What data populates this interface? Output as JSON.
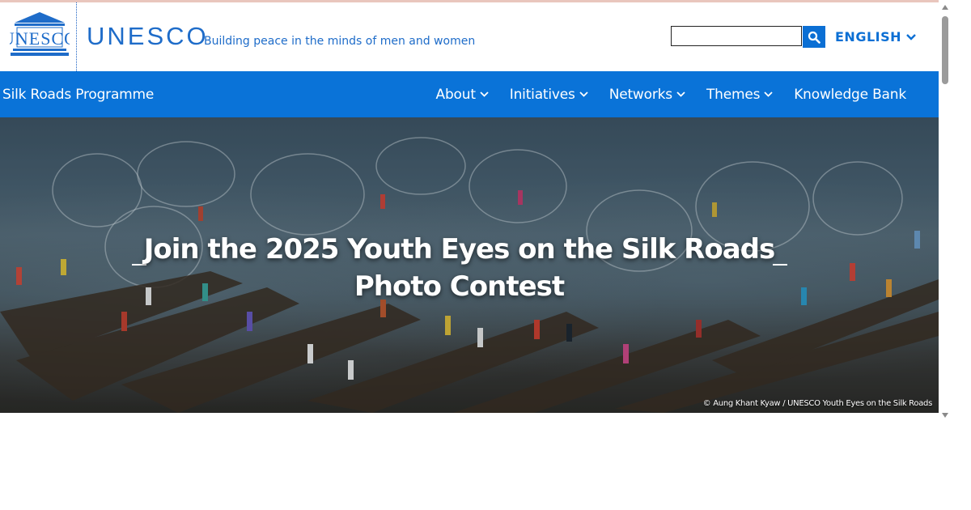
{
  "header": {
    "logo_text": "UNESCO",
    "brand": "UNESCO",
    "tagline": "Building peace in the minds of men and women",
    "search": {
      "value": "",
      "placeholder": ""
    },
    "language": "ENGLISH"
  },
  "navbar": {
    "site_name": "Silk Roads Programme",
    "items": [
      {
        "label": "About",
        "has_dropdown": true
      },
      {
        "label": "Initiatives",
        "has_dropdown": true
      },
      {
        "label": "Networks",
        "has_dropdown": true
      },
      {
        "label": "Themes",
        "has_dropdown": true
      },
      {
        "label": "Knowledge Bank",
        "has_dropdown": false
      }
    ]
  },
  "hero": {
    "title": "Join the 2025 Youth Eyes on the Silk Roads Photo Contest",
    "credit": "© Aung Khant Kyaw / UNESCO Youth Eyes on the Silk Roads"
  },
  "colors": {
    "brand_blue": "#1e6cc9",
    "nav_blue": "#0a73d8",
    "search_button": "#0b6fd4"
  },
  "icons": [
    "unesco-temple-logo",
    "search-icon",
    "chevron-down-icon"
  ]
}
